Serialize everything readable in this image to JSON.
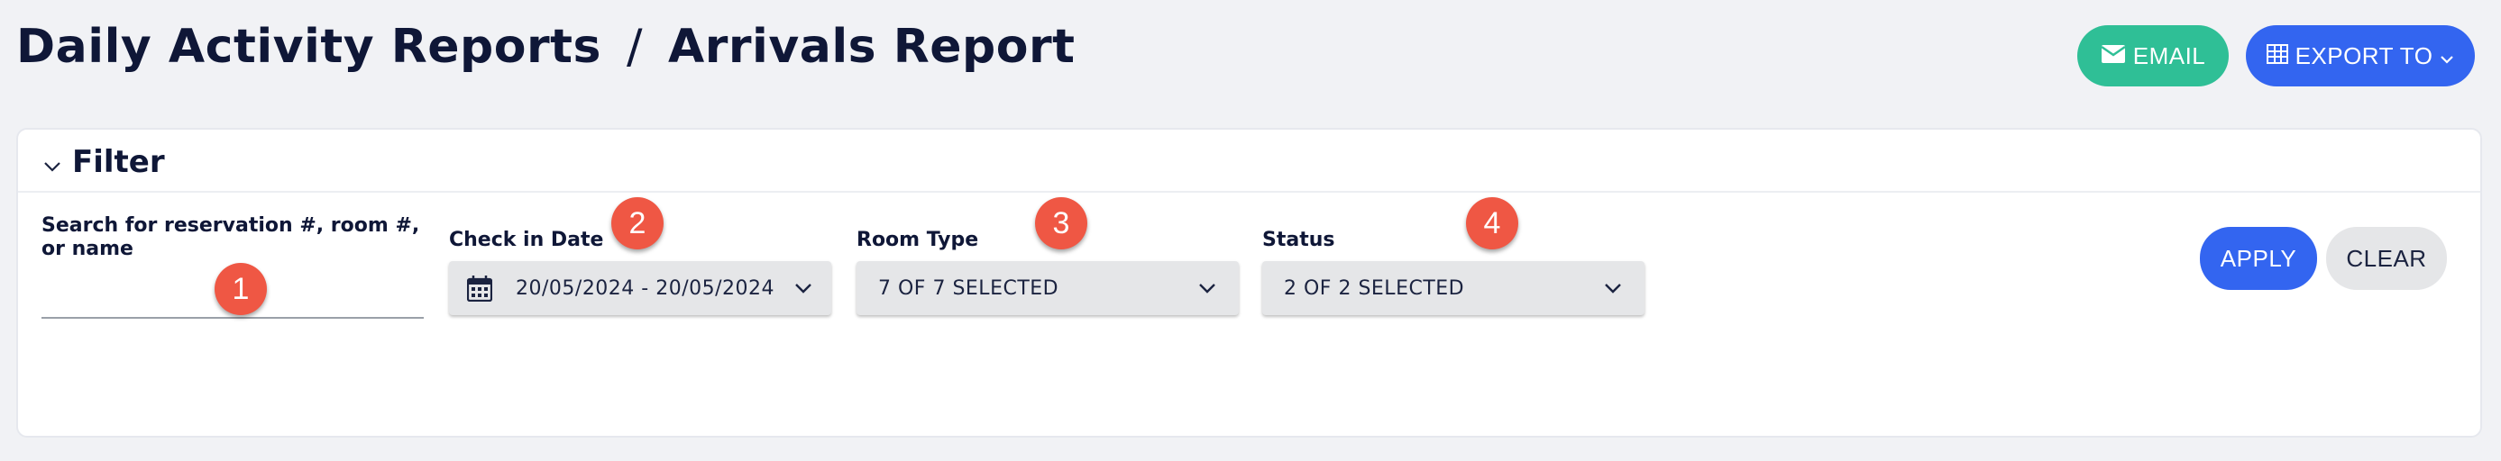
{
  "header": {
    "breadcrumb_parent": "Daily Activity Reports",
    "separator": "/",
    "page_title": "Arrivals Report",
    "email_label": "EMAIL",
    "export_label": "EXPORT TO"
  },
  "filter": {
    "title": "Filter",
    "search_label": "Search for reservation #, room #, or name",
    "search_value": "",
    "checkin_label": "Check in Date",
    "checkin_value": "20/05/2024 - 20/05/2024",
    "room_type_label": "Room Type",
    "room_type_value": "7 OF 7 SELECTED",
    "status_label": "Status",
    "status_value": "2 OF 2 SELECTED",
    "apply_label": "APPLY",
    "clear_label": "CLEAR"
  },
  "badges": [
    "1",
    "2",
    "3",
    "4"
  ],
  "colors": {
    "email": "#2fbf96",
    "primary": "#3365f0",
    "badge": "#ef5744"
  }
}
